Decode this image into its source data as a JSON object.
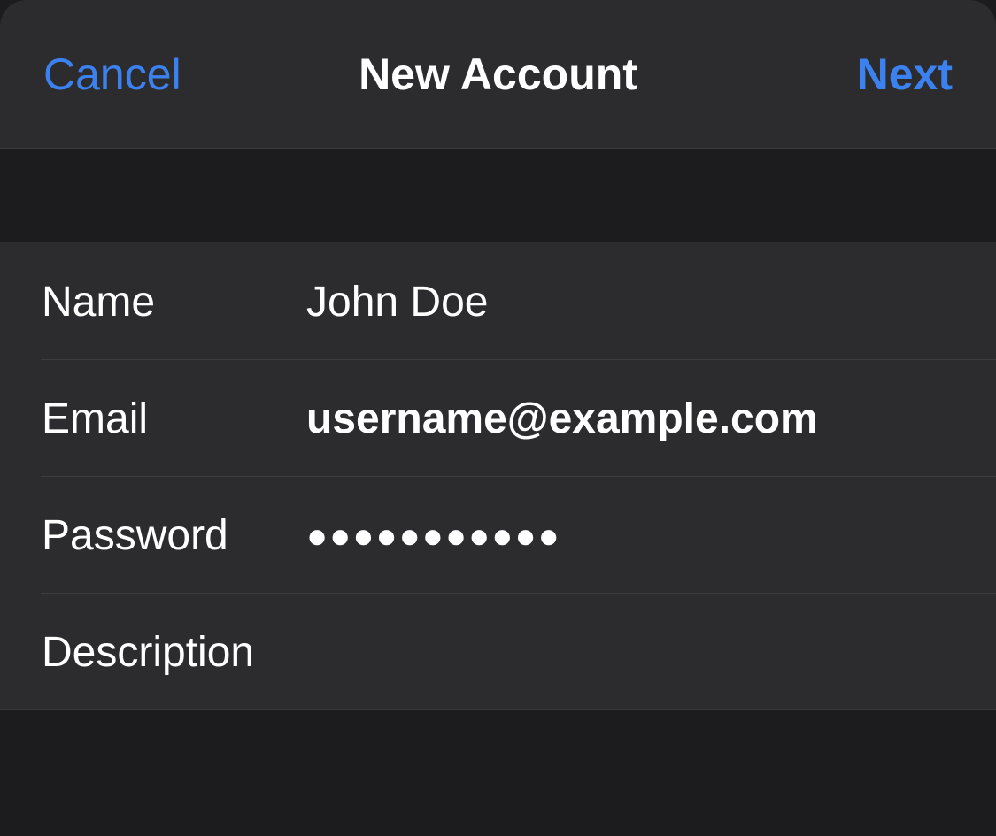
{
  "navbar": {
    "cancel_label": "Cancel",
    "title": "New Account",
    "next_label": "Next"
  },
  "form": {
    "rows": [
      {
        "label": "Name",
        "value": "John Doe"
      },
      {
        "label": "Email",
        "value": "username@example.com"
      },
      {
        "label": "Password",
        "value": "●●●●●●●●●●●"
      },
      {
        "label": "Description",
        "value": ""
      }
    ]
  },
  "colors": {
    "accent": "#3b82f0",
    "background": "#1c1c1e",
    "cell": "#2c2c2e",
    "separator": "#3a3a3c",
    "text": "#ffffff"
  }
}
